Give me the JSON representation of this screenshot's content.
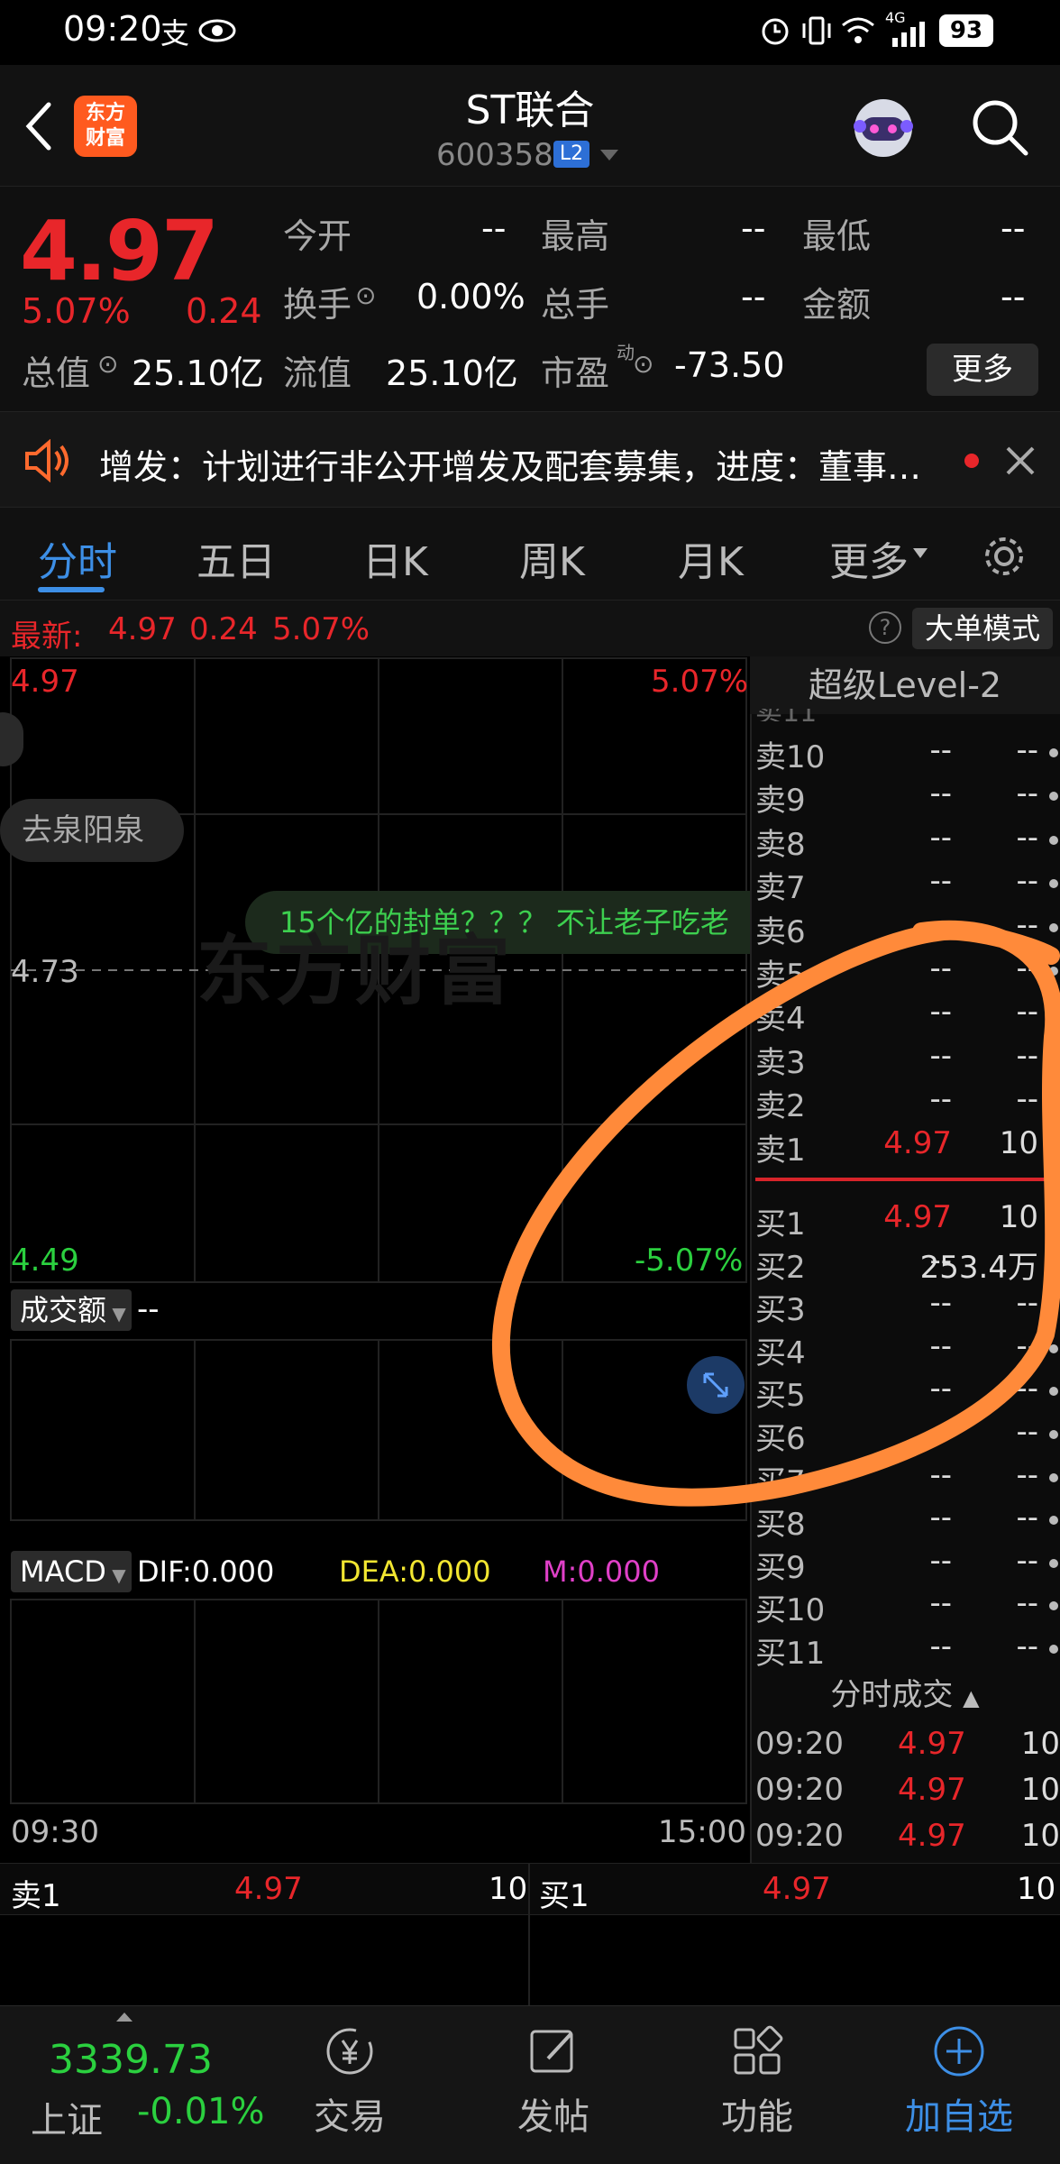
{
  "status_bar": {
    "time": "09:20",
    "battery": "93",
    "network": "4G"
  },
  "header": {
    "title": "ST联合",
    "code": "600358",
    "level_badge": "L2",
    "logo_text": "东方财富"
  },
  "quote": {
    "price": "4.97",
    "change_pct": "5.07%",
    "change": "0.24",
    "open_label": "今开",
    "open_value": "--",
    "high_label": "最高",
    "high_value": "--",
    "low_label": "最低",
    "low_value": "--",
    "turnover_label": "换手",
    "turnover_value": "0.00%",
    "volume_label": "总手",
    "volume_value": "--",
    "amount_label": "金额",
    "amount_value": "--",
    "mktcap_label": "总值",
    "mktcap_value": "25.10亿",
    "float_label": "流值",
    "float_value": "25.10亿",
    "pe_label": "市盈",
    "pe_sup": "动",
    "pe_value": "-73.50",
    "more_label": "更多"
  },
  "notice": {
    "text": "增发：计划进行非公开增发及配套募集，进度：董事…"
  },
  "tabs": [
    {
      "label": "分时"
    },
    {
      "label": "五日"
    },
    {
      "label": "日K"
    },
    {
      "label": "周K"
    },
    {
      "label": "月K"
    },
    {
      "label": "更多"
    }
  ],
  "latest_bar": {
    "label": "最新:",
    "price": "4.97",
    "change": "0.24",
    "pct": "5.07%",
    "mode_button": "大单模式"
  },
  "chart": {
    "top_price": "4.97",
    "top_pct": "5.07%",
    "mid_price": "4.73",
    "bottom_price": "4.49",
    "bottom_pct": "-5.07%",
    "bubble_tag": "去泉阳泉",
    "comment": "15个亿的封单？？？ 不让老子吃老",
    "watermark": "东方财富",
    "volume_label": "成交额",
    "volume_value": "--",
    "macd_label": "MACD",
    "dif": "DIF:0.000",
    "dea": "DEA:0.000",
    "m": "M:0.000",
    "time_start": "09:30",
    "time_end": "15:00"
  },
  "orderbook": {
    "title": "超级Level-2",
    "partial_top": "卖11",
    "asks": [
      {
        "name": "卖10",
        "price": "--",
        "vol": "--"
      },
      {
        "name": "卖9",
        "price": "--",
        "vol": "--"
      },
      {
        "name": "卖8",
        "price": "--",
        "vol": "--"
      },
      {
        "name": "卖7",
        "price": "--",
        "vol": "--"
      },
      {
        "name": "卖6",
        "price": "--",
        "vol": "--"
      },
      {
        "name": "卖5",
        "price": "--",
        "vol": "--"
      },
      {
        "name": "卖4",
        "price": "--",
        "vol": "--"
      },
      {
        "name": "卖3",
        "price": "--",
        "vol": "--"
      },
      {
        "name": "卖2",
        "price": "--",
        "vol": "--"
      },
      {
        "name": "卖1",
        "price": "4.97",
        "vol": "10"
      }
    ],
    "bids": [
      {
        "name": "买1",
        "price": "4.97",
        "vol": "10"
      },
      {
        "name": "买2",
        "price": "--",
        "vol": "253.4万"
      },
      {
        "name": "买3",
        "price": "--",
        "vol": "--"
      },
      {
        "name": "买4",
        "price": "--",
        "vol": "--"
      },
      {
        "name": "买5",
        "price": "--",
        "vol": "--"
      },
      {
        "name": "买6",
        "price": "--",
        "vol": "--"
      },
      {
        "name": "买7",
        "price": "--",
        "vol": "--"
      },
      {
        "name": "买8",
        "price": "--",
        "vol": "--"
      },
      {
        "name": "买9",
        "price": "--",
        "vol": "--"
      },
      {
        "name": "买10",
        "price": "--",
        "vol": "--"
      },
      {
        "name": "买11",
        "price": "--",
        "vol": "--"
      }
    ],
    "trades_title": "分时成交",
    "trades": [
      {
        "time": "09:20",
        "price": "4.97",
        "vol": "10"
      },
      {
        "time": "09:20",
        "price": "4.97",
        "vol": "10"
      },
      {
        "time": "09:20",
        "price": "4.97",
        "vol": "10"
      }
    ]
  },
  "level1": {
    "sell_name": "卖1",
    "sell_price": "4.97",
    "sell_vol": "10",
    "buy_name": "买1",
    "buy_price": "4.97",
    "buy_vol": "10"
  },
  "bottom_nav": {
    "index_value": "3339.73",
    "index_name": "上证",
    "index_pct": "-0.01%",
    "items": [
      {
        "label": "交易"
      },
      {
        "label": "发帖"
      },
      {
        "label": "功能"
      },
      {
        "label": "加自选"
      }
    ]
  },
  "colors": {
    "up": "#e8262a",
    "down": "#2bd03f",
    "accent": "#3d8fe6",
    "annotation": "#ff8a3a"
  }
}
